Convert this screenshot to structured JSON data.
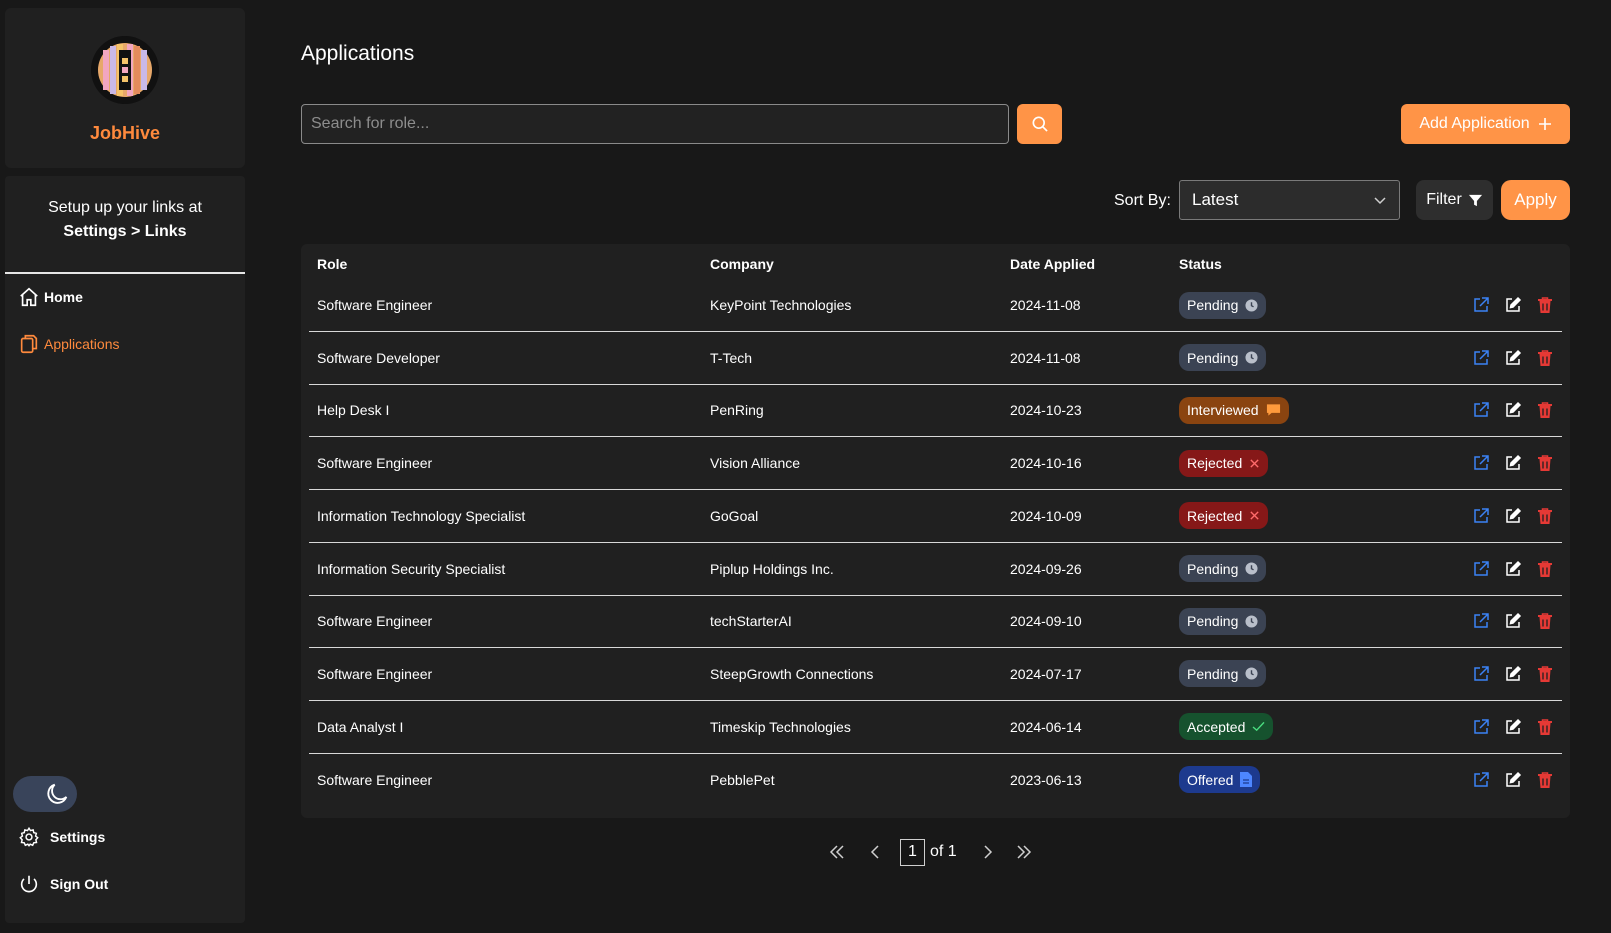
{
  "app": {
    "name": "JobHive"
  },
  "sidebar": {
    "note_line1": "Setup up your links at",
    "note_line2": "Settings > Links",
    "nav": {
      "home": "Home",
      "applications": "Applications"
    },
    "bottom": {
      "settings": "Settings",
      "sign_out": "Sign Out"
    }
  },
  "page": {
    "title": "Applications"
  },
  "search": {
    "placeholder": "Search for role..."
  },
  "toolbar": {
    "add_label": "Add Application",
    "sort_label": "Sort By:",
    "sort_value": "Latest",
    "filter_label": "Filter",
    "apply_label": "Apply"
  },
  "table": {
    "headers": {
      "role": "Role",
      "company": "Company",
      "date": "Date Applied",
      "status": "Status"
    },
    "rows": [
      {
        "role": "Software Engineer",
        "company": "KeyPoint Technologies",
        "date": "2024-11-08",
        "status": "Pending"
      },
      {
        "role": "Software Developer",
        "company": "T-Tech",
        "date": "2024-11-08",
        "status": "Pending"
      },
      {
        "role": "Help Desk I",
        "company": "PenRing",
        "date": "2024-10-23",
        "status": "Interviewed"
      },
      {
        "role": "Software Engineer",
        "company": "Vision Alliance",
        "date": "2024-10-16",
        "status": "Rejected"
      },
      {
        "role": "Information Technology Specialist",
        "company": "GoGoal",
        "date": "2024-10-09",
        "status": "Rejected"
      },
      {
        "role": "Information Security Specialist",
        "company": "Piplup Holdings Inc.",
        "date": "2024-09-26",
        "status": "Pending"
      },
      {
        "role": "Software Engineer",
        "company": "techStarterAI",
        "date": "2024-09-10",
        "status": "Pending"
      },
      {
        "role": "Software Engineer",
        "company": "SteepGrowth Connections",
        "date": "2024-07-17",
        "status": "Pending"
      },
      {
        "role": "Data Analyst I",
        "company": "Timeskip Technologies",
        "date": "2024-06-14",
        "status": "Accepted"
      },
      {
        "role": "Software Engineer",
        "company": "PebblePet",
        "date": "2023-06-13",
        "status": "Offered"
      }
    ]
  },
  "pagination": {
    "current": "1",
    "of_label": "of 1"
  },
  "colors": {
    "accent": "#ff9447",
    "brand": "#ff8a3d",
    "pending": "#3b4353",
    "interviewed": "#8a4410",
    "rejected": "#861818",
    "accepted": "#16522e",
    "offered": "#1d3a8e",
    "delete": "#e53935",
    "open_link": "#3b82f6"
  },
  "icons": {
    "pending": "clock-icon",
    "interviewed": "chat-bubble-icon",
    "rejected": "x-icon",
    "accepted": "check-icon",
    "offered": "document-icon"
  }
}
